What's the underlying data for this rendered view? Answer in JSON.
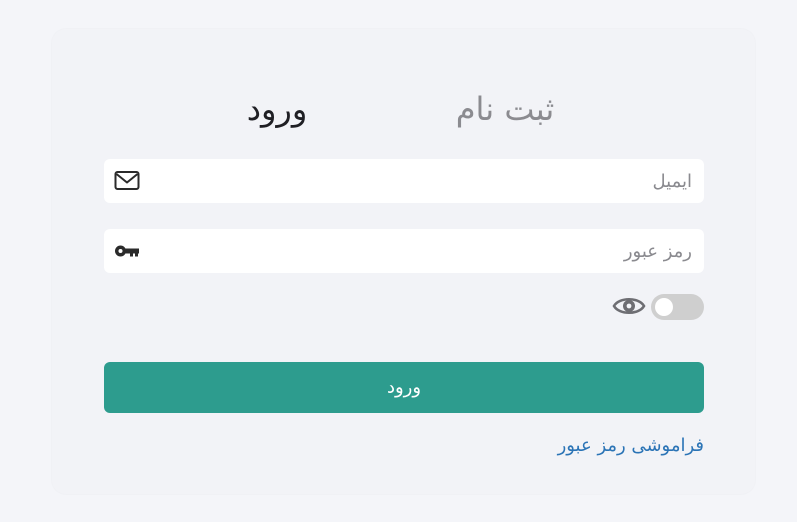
{
  "tabs": {
    "login_label": "ورود",
    "register_label": "ثبت نام"
  },
  "form": {
    "email": {
      "placeholder": "ایمیل",
      "value": "",
      "icon": "envelope-icon"
    },
    "password": {
      "placeholder": "رمز عبور",
      "value": "",
      "icon": "key-icon"
    },
    "show_password": {
      "icon": "eye-icon",
      "enabled": false
    },
    "submit_label": "ورود",
    "forgot_label": "فراموشی رمز عبور"
  },
  "colors": {
    "background": "#f4f5f9",
    "card": "#f2f3f7",
    "accent": "#2d9c8e",
    "link": "#2b74b6",
    "toggle_off": "#cfcfcf"
  }
}
